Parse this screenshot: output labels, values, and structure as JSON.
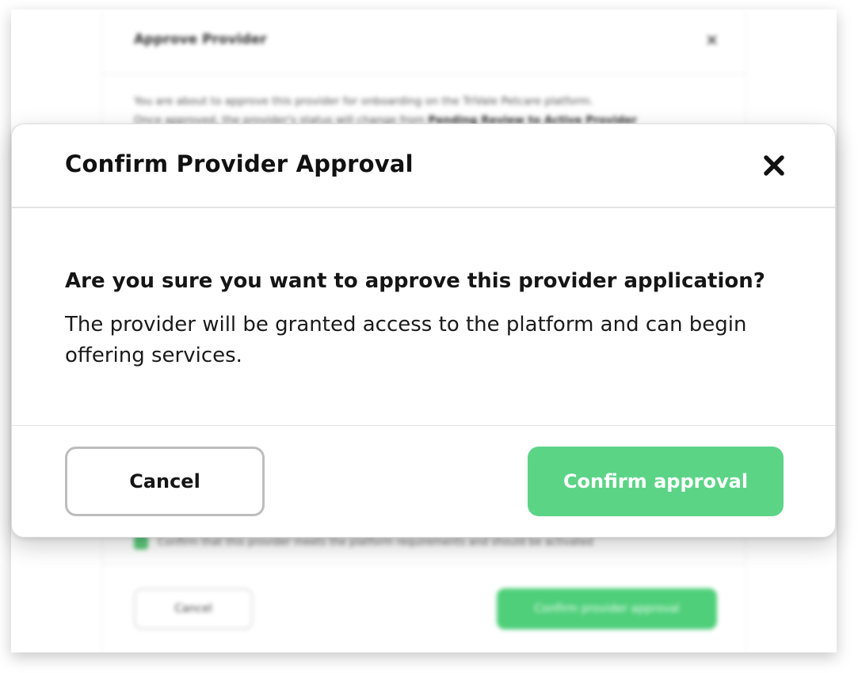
{
  "background_dialog": {
    "title": "Approve Provider",
    "close_glyph": "×",
    "body_line_1": "You are about to approve this provider for onboarding on the TriVale Petcare platform.",
    "body_line_2_prefix": "Once approved, the provider's status will change from",
    "body_line_2_bold": "Pending Review to Active Provider",
    "checkbox_label": "Confirm that this provider meets the platform requirements and should be activated",
    "cancel_label": "Cancel",
    "confirm_label": "Confirm provider approval"
  },
  "modal": {
    "title": "Confirm Provider Approval",
    "close_icon": "close-icon",
    "question": "Are you sure you want to approve this provider application?",
    "explanation": "The provider will be granted access to the platform and can begin offering services.",
    "cancel_label": "Cancel",
    "confirm_label": "Confirm approval"
  },
  "colors": {
    "confirm_green": "#5bd486",
    "cancel_border": "#bdbdbd",
    "text_dark": "#111111"
  }
}
